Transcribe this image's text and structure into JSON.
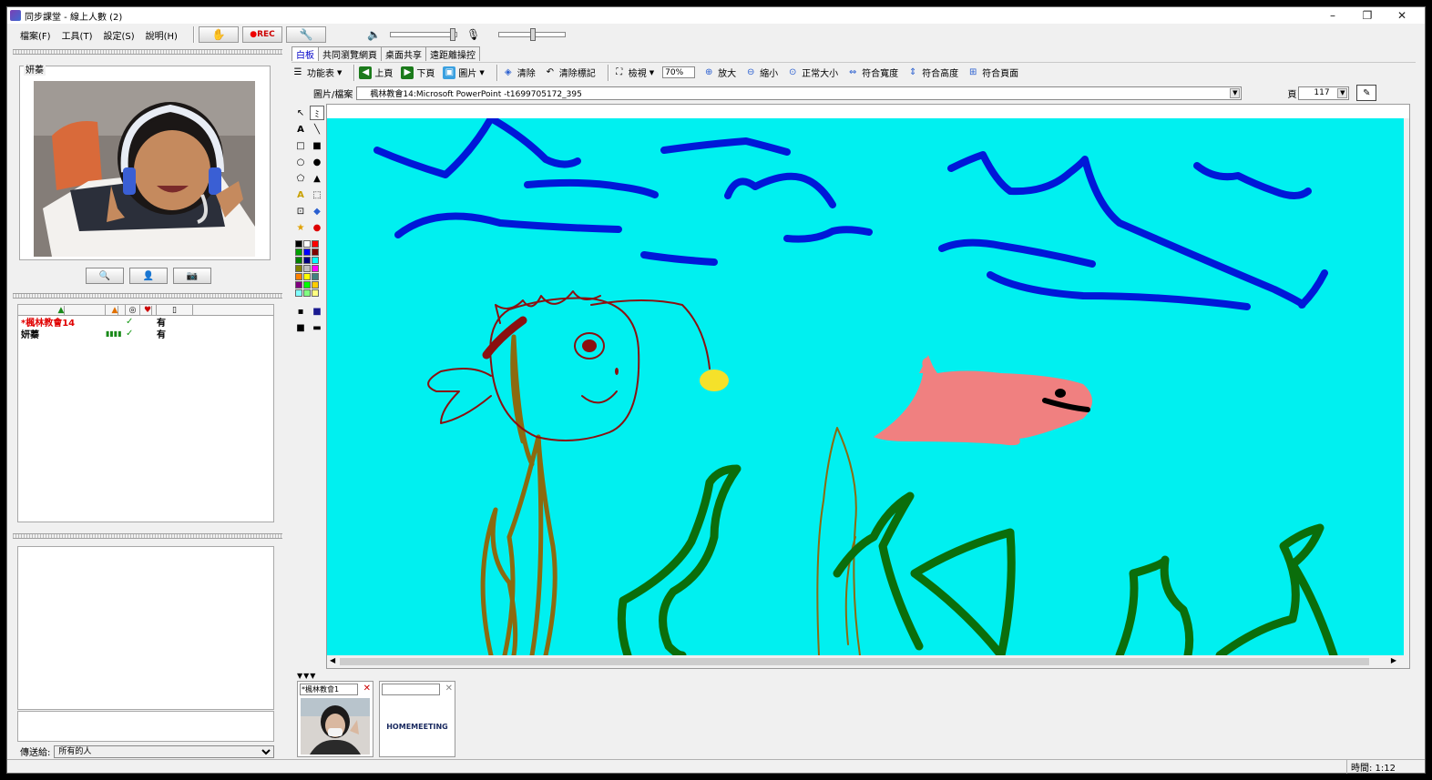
{
  "window": {
    "title": "同步課堂 - 線上人數 (2)",
    "controls": [
      "–",
      "❐",
      "✕"
    ]
  },
  "menu": [
    "檔案(F)",
    "工具(T)",
    "設定(S)",
    "說明(H)"
  ],
  "topbar": {
    "rec_label": "REC",
    "speaker_volume": 0.95,
    "mic_volume": 0.5
  },
  "left": {
    "video_name": "妍蓁",
    "users": [
      {
        "name": "*楓林教會14",
        "mic": "",
        "ok": "✓",
        "has": "有",
        "color": "#e00000"
      },
      {
        "name": "妍蓁",
        "mic": "▮▮▮▮",
        "ok": "✓",
        "has": "有",
        "color": "#000000"
      }
    ],
    "send_to_label": "傳送給:",
    "send_to_value": "所有的人"
  },
  "tabs": [
    "白板",
    "共同瀏覽網頁",
    "桌面共享",
    "遠距離操控"
  ],
  "toolbar": {
    "function_table": "功能表",
    "prev_page": "上頁",
    "next_page": "下頁",
    "picture": "圖片",
    "clear": "清除",
    "clear_marks": "清除標記",
    "view": "檢視",
    "zoom": "70%",
    "zoom_in": "放大",
    "zoom_out": "縮小",
    "normal_size": "正常大小",
    "fit_width": "符合寬度",
    "fit_height": "符合高度",
    "fit_page": "符合頁面"
  },
  "filebar": {
    "label": "圖片/檔案",
    "file": "楓林教會14:Microsoft PowerPoint -t1699705172_395",
    "page_label": "頁",
    "page_value": "117"
  },
  "board": {
    "background": "#00f0f0",
    "wave_color": "#0018d8",
    "fish_color": "#8b1010",
    "shark_color": "#f08080",
    "weed_color": "#0b6e0b",
    "stem_color": "#8b6a10"
  },
  "thumbs": [
    {
      "select": "*楓林教會1"
    },
    {
      "select": "",
      "logo": "HOMEMEETING"
    }
  ],
  "status": {
    "time": "時間: 1:12"
  }
}
